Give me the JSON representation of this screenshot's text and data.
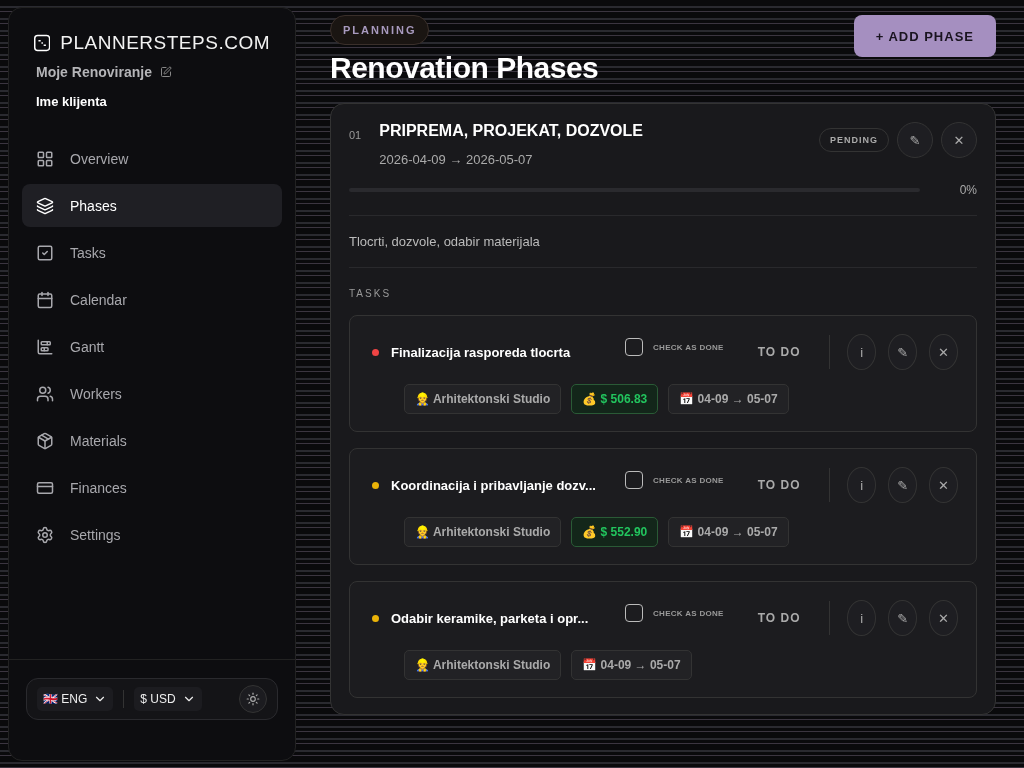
{
  "sidebar": {
    "brand": "PLANNERSTEPS.COM",
    "project": "Moje Renoviranje",
    "client": "Ime klijenta",
    "items": [
      {
        "label": "Overview",
        "selected": false
      },
      {
        "label": "Phases",
        "selected": true
      },
      {
        "label": "Tasks",
        "selected": false
      },
      {
        "label": "Calendar",
        "selected": false
      },
      {
        "label": "Gantt",
        "selected": false
      },
      {
        "label": "Workers",
        "selected": false
      },
      {
        "label": "Materials",
        "selected": false
      },
      {
        "label": "Finances",
        "selected": false
      },
      {
        "label": "Settings",
        "selected": false
      }
    ],
    "language": "🇬🇧 ENG",
    "currency": "$ USD"
  },
  "header": {
    "badge": "PLANNING",
    "title": "Renovation Phases",
    "add_button": "+ ADD PHASE"
  },
  "phase": {
    "number": "01",
    "title": "PRIPREMA, PROJEKAT, DOZVOLE",
    "dates": "2026-04-09 → 2026-05-07",
    "status": "PENDING",
    "edit": "✎",
    "delete": "✕",
    "level": 0,
    "percent": "0%",
    "description": "Tlocrti, dozvole, odabir materijala",
    "tasks_label": "TASKS",
    "tasks": [
      {
        "title": "Finalizacija rasporeda tlocrta",
        "color": "#ef4444",
        "checked": false,
        "check_label": "CHECK AS DONE",
        "status": "TO DO",
        "info": "i",
        "edit": "✎",
        "delete": "✕",
        "chips": [
          {
            "kind": "worker",
            "text": "👷 Arhitektonski Studio"
          },
          {
            "kind": "cost",
            "text": "💰 $ 506.83"
          },
          {
            "kind": "date",
            "text": "📅 04-09 → 05-07"
          }
        ]
      },
      {
        "title": "Koordinacija i pribavljanje dozv...",
        "color": "#eab308",
        "checked": false,
        "check_label": "CHECK AS DONE",
        "status": "TO DO",
        "info": "i",
        "edit": "✎",
        "delete": "✕",
        "chips": [
          {
            "kind": "worker",
            "text": "👷 Arhitektonski Studio"
          },
          {
            "kind": "cost",
            "text": "💰 $ 552.90"
          },
          {
            "kind": "date",
            "text": "📅 04-09 → 05-07"
          }
        ]
      },
      {
        "title": "Odabir keramike, parketa i opr...",
        "color": "#eab308",
        "checked": false,
        "check_label": "CHECK AS DONE",
        "status": "TO DO",
        "info": "i",
        "edit": "✎",
        "delete": "✕",
        "chips": [
          {
            "kind": "worker",
            "text": "👷 Arhitektonski Studio"
          },
          {
            "kind": "date",
            "text": "📅 04-09 → 05-07"
          }
        ]
      }
    ]
  }
}
